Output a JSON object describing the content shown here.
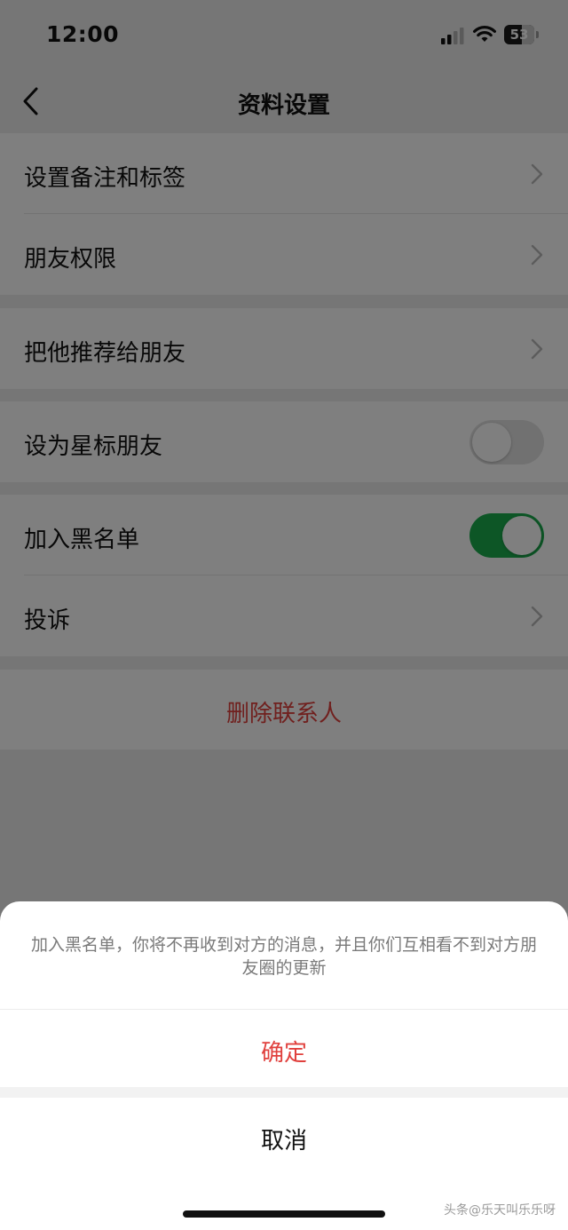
{
  "status_bar": {
    "time": "12:00",
    "battery_level": "53"
  },
  "nav": {
    "title": "资料设置"
  },
  "groups": [
    {
      "items": [
        {
          "label": "设置备注和标签",
          "control": "chevron"
        },
        {
          "label": "朋友权限",
          "control": "chevron"
        }
      ]
    },
    {
      "items": [
        {
          "label": "把他推荐给朋友",
          "control": "chevron"
        }
      ]
    },
    {
      "items": [
        {
          "label": "设为星标朋友",
          "control": "toggle",
          "on": false
        }
      ]
    },
    {
      "items": [
        {
          "label": "加入黑名单",
          "control": "toggle",
          "on": true
        },
        {
          "label": "投诉",
          "control": "chevron"
        }
      ]
    }
  ],
  "delete_contact": {
    "label": "删除联系人"
  },
  "sheet": {
    "message": "加入黑名单，你将不再收到对方的消息，并且你们互相看不到对方朋友圈的更新",
    "confirm_label": "确定",
    "cancel_label": "取消"
  },
  "watermark": "头条@乐天叫乐乐呀",
  "colors": {
    "accent_red": "#e0403d",
    "toggle_on": "#1aad4d",
    "toggle_off": "#e2e2e2",
    "page_background": "#ededed"
  }
}
